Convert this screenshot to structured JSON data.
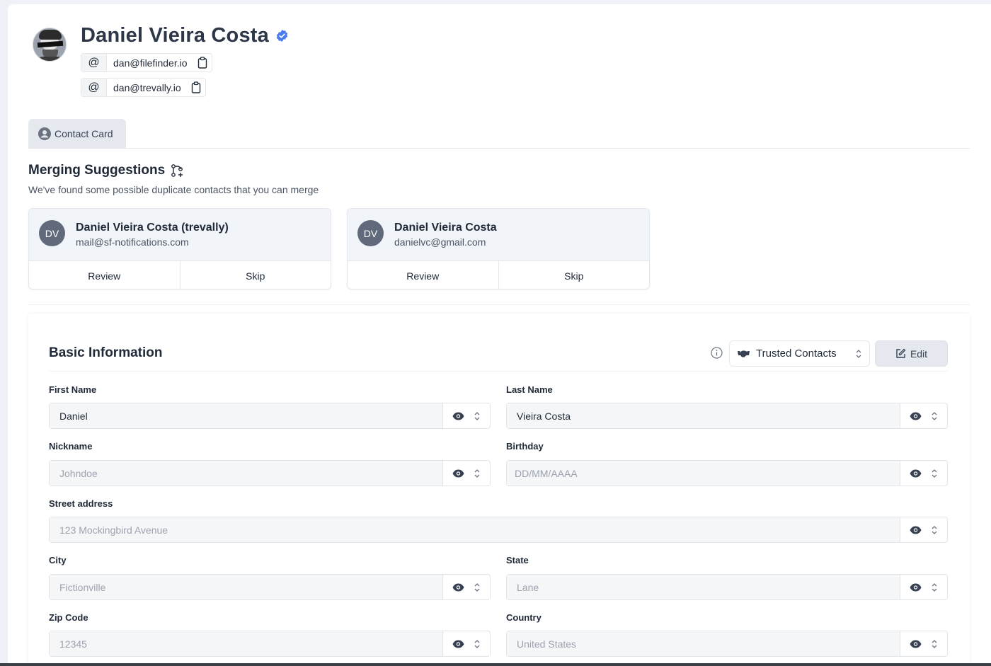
{
  "profile": {
    "name": "Daniel Vieira Costa",
    "emails": [
      {
        "at": "@",
        "address": "dan@filefinder.io"
      },
      {
        "at": "@",
        "address": "dan@trevally.io"
      }
    ]
  },
  "tabs": [
    {
      "label": "Contact Card"
    }
  ],
  "merging": {
    "title": "Merging Suggestions",
    "subtitle": "We've found some possible duplicate contacts that you can merge",
    "cards": [
      {
        "initials": "DV",
        "name": "Daniel Vieira Costa (trevally)",
        "email": "mail@sf-notifications.com",
        "review": "Review",
        "skip": "Skip"
      },
      {
        "initials": "DV",
        "name": "Daniel Vieira Costa",
        "email": "danielvc@gmail.com",
        "review": "Review",
        "skip": "Skip"
      }
    ]
  },
  "basic_info": {
    "title": "Basic Information",
    "visibility": "Trusted Contacts",
    "edit_label": "Edit",
    "fields": {
      "first_name": {
        "label": "First Name",
        "value": "Daniel"
      },
      "last_name": {
        "label": "Last Name",
        "value": "Vieira Costa"
      },
      "nickname": {
        "label": "Nickname",
        "placeholder": "Johndoe"
      },
      "birthday": {
        "label": "Birthday",
        "placeholder": "DD/MM/AAAA"
      },
      "street": {
        "label": "Street address",
        "placeholder": "123 Mockingbird Avenue"
      },
      "city": {
        "label": "City",
        "placeholder": "Fictionville"
      },
      "state": {
        "label": "State",
        "placeholder": "Lane"
      },
      "zip": {
        "label": "Zip Code",
        "placeholder": "12345"
      },
      "country": {
        "label": "Country",
        "placeholder": "United States"
      }
    }
  },
  "colors": {
    "accent": "#4a7cf0",
    "avatar_bg": "#606a7b"
  }
}
